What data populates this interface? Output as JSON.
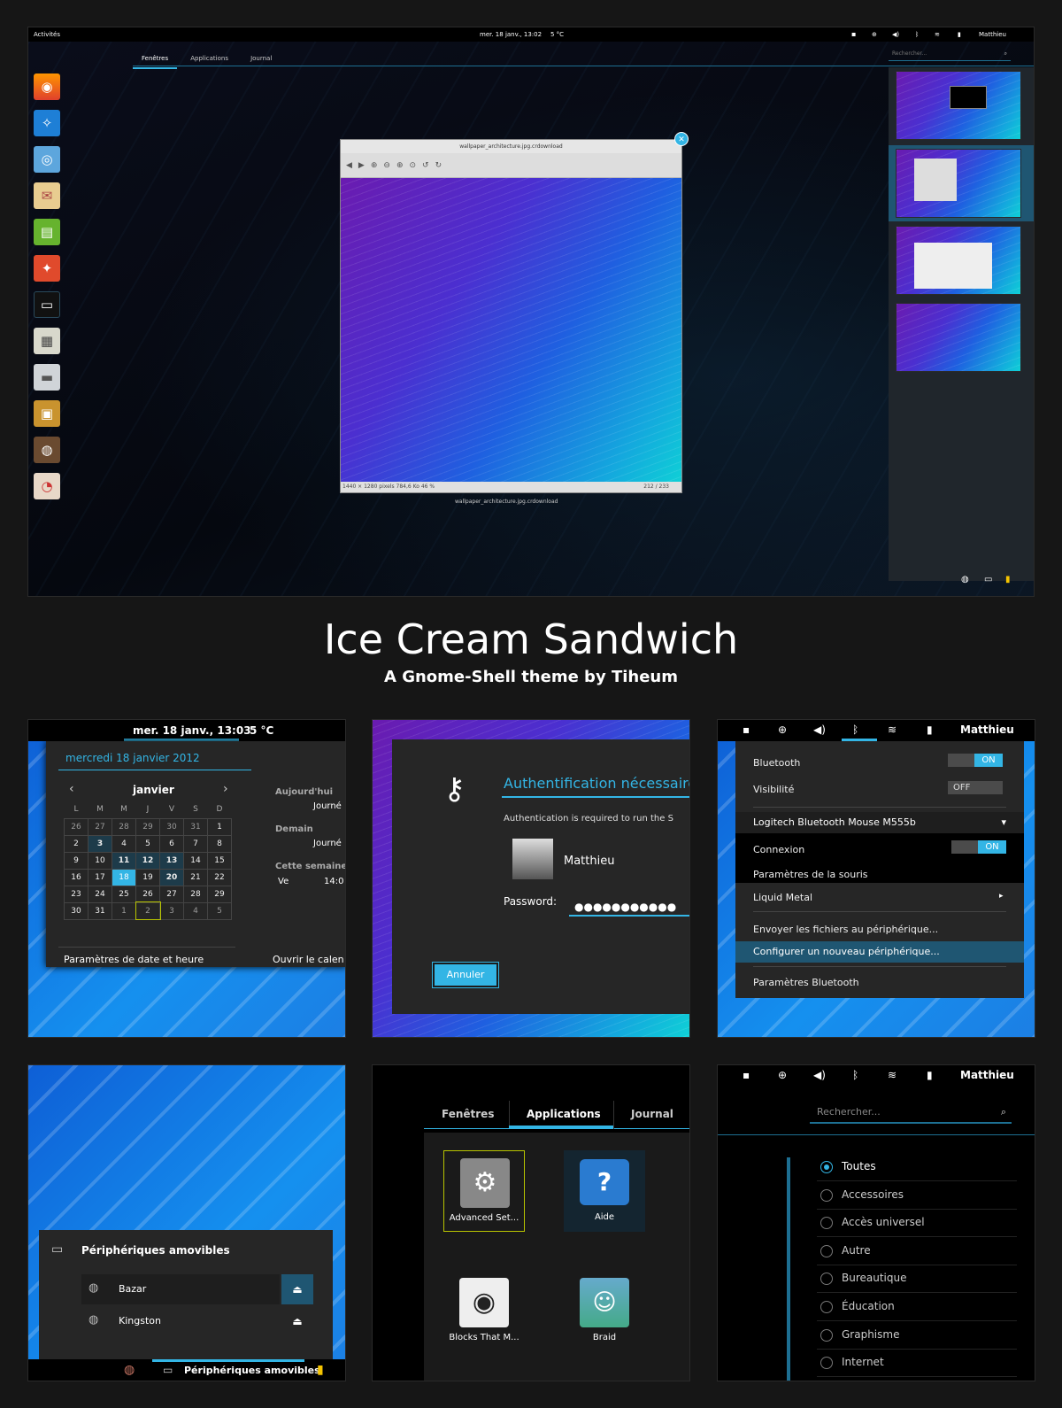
{
  "main": {
    "topbar": {
      "activities": "Activités",
      "clock": "mer. 18 janv., 13:02",
      "weather": "5 °C",
      "user": "Matthieu"
    },
    "tabs": [
      "Fenêtres",
      "Applications",
      "Journal"
    ],
    "search_placeholder": "Rechercher...",
    "window": {
      "title": "wallpaper_architecture.jpg.crdownload",
      "status_left": "1440 × 1280 pixels  784,6 Ko   46 %",
      "status_right": "212 / 233",
      "caption": "wallpaper_architecture.jpg.crdownload"
    },
    "dash_icons": [
      "firefox-icon",
      "safari-icon",
      "chromium-icon",
      "stamp-icon",
      "gparted-icon",
      "software-icon",
      "terminal-icon",
      "calculator-icon",
      "settings-icon",
      "archive-icon",
      "speaker-icon",
      "eye-icon"
    ]
  },
  "title": {
    "main": "Ice Cream Sandwich",
    "sub": "A Gnome-Shell theme by Tiheum"
  },
  "calendar": {
    "clock": "mer. 18 janv., 13:03",
    "weather": "5 °C",
    "date_full": "mercredi 18 janvier 2012",
    "month": "janvier",
    "weekdays": [
      "L",
      "M",
      "M",
      "J",
      "V",
      "S",
      "D"
    ],
    "rows": [
      [
        "26",
        "27",
        "28",
        "29",
        "30",
        "31",
        "1"
      ],
      [
        "2",
        "3",
        "4",
        "5",
        "6",
        "7",
        "8"
      ],
      [
        "9",
        "10",
        "11",
        "12",
        "13",
        "14",
        "15"
      ],
      [
        "16",
        "17",
        "18",
        "19",
        "20",
        "21",
        "22"
      ],
      [
        "23",
        "24",
        "25",
        "26",
        "27",
        "28",
        "29"
      ],
      [
        "30",
        "31",
        "1",
        "2",
        "3",
        "4",
        "5"
      ]
    ],
    "today_label": "Aujourd'hui",
    "today_event": "Journé",
    "tomorrow_label": "Demain",
    "tomorrow_event": "Journé",
    "week_label": "Cette semaine",
    "week_day": "Ve",
    "week_time": "14:0",
    "settings_link": "Paramètres de date et heure",
    "open_link": "Ouvrir le calen"
  },
  "auth": {
    "title": "Authentification nécessaire",
    "message": "Authentication is required to run the S",
    "user": "Matthieu",
    "password_label": "Password:",
    "password_dots": "●●●●●●●●●●●",
    "cancel": "Annuler"
  },
  "bluetooth": {
    "user": "Matthieu",
    "bluetooth_label": "Bluetooth",
    "bluetooth_state": "ON",
    "visibility_label": "Visibilité",
    "visibility_state": "OFF",
    "device": "Logitech Bluetooth Mouse M555b",
    "connection_label": "Connexion",
    "connection_state": "ON",
    "mouse_settings": "Paramètres de la souris",
    "liquid": "Liquid Metal",
    "send_files": "Envoyer les fichiers au périphérique...",
    "configure": "Configurer un nouveau périphérique...",
    "bt_settings": "Paramètres Bluetooth"
  },
  "removable": {
    "title": "Périphériques amovibles",
    "devices": [
      "Bazar",
      "Kingston"
    ],
    "taskbar_label": "Périphériques amovibles"
  },
  "apps": {
    "tabs": [
      "Fenêtres",
      "Applications",
      "Journal"
    ],
    "items": [
      "Advanced Set...",
      "Aide",
      "Blocks That M...",
      "Braid"
    ]
  },
  "categories": {
    "user": "Matthieu",
    "search_placeholder": "Rechercher...",
    "items": [
      "Toutes",
      "Accessoires",
      "Accès universel",
      "Autre",
      "Bureautique",
      "Éducation",
      "Graphisme",
      "Internet"
    ]
  }
}
